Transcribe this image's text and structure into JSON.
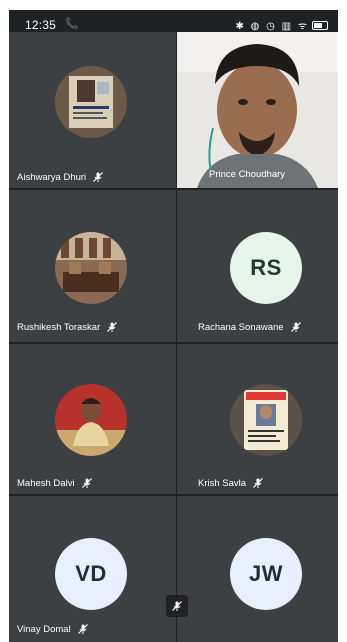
{
  "status_bar": {
    "time": "12:35",
    "call_indicator": "phone-call-icon",
    "status_icons_text": "✱ ◍ ◷ ▥ ᯤ"
  },
  "participants": [
    {
      "name": "Aishwarya Dhuri",
      "avatar": "photo",
      "muted": true
    },
    {
      "name": "Prince Choudhary",
      "avatar": "video",
      "muted": false
    },
    {
      "name": "Rushikesh Toraskar",
      "avatar": "photo",
      "muted": true
    },
    {
      "name": "Rachana Sonawane",
      "avatar": "initials",
      "initials": "RS",
      "muted": true
    },
    {
      "name": "Mahesh Dalvi",
      "avatar": "photo",
      "muted": true
    },
    {
      "name": "Krish Savla",
      "avatar": "photo",
      "muted": true
    },
    {
      "name": "Vinay Domal",
      "avatar": "initials",
      "initials": "VD",
      "muted": true
    },
    {
      "name": "",
      "avatar": "initials",
      "initials": "JW",
      "muted": false
    }
  ],
  "colors": {
    "background": "#202124",
    "tile": "#3c4043",
    "initials_bg": "#e8f0fe",
    "initials_text": "#1f2d3d",
    "rs_bg": "#e6f4ea",
    "rs_text": "#1f3b2b"
  },
  "icons": {
    "muted": "mic-off-icon",
    "local_mic": "mic-off-icon"
  }
}
